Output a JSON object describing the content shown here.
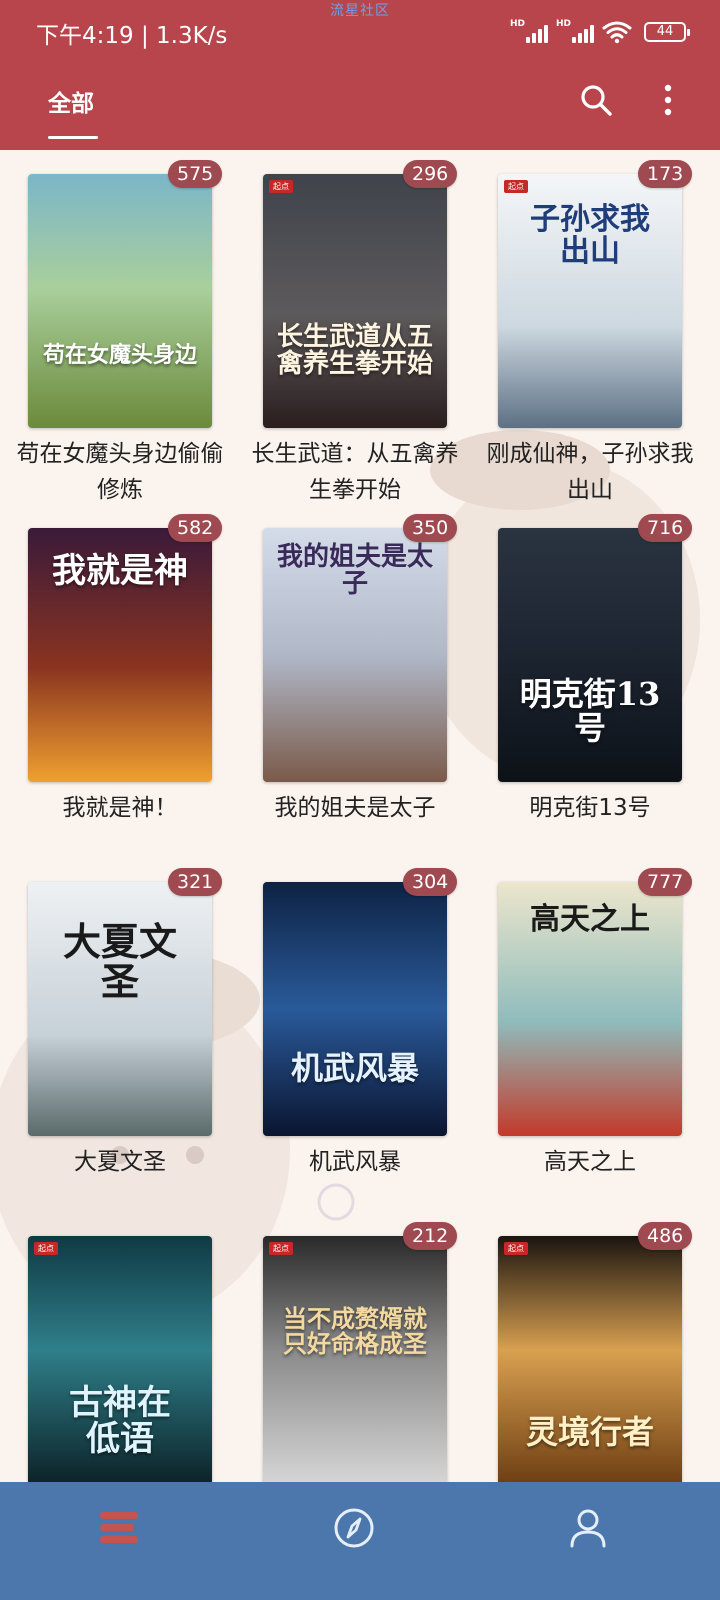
{
  "status_bar": {
    "time_speed": "下午4:19 | 1.3K/s",
    "watermark": "流星社区",
    "hd1": "HD",
    "hd2": "HD",
    "battery": "44"
  },
  "app_bar": {
    "tab_label": "全部",
    "icons": [
      "search-icon",
      "more-vert-icon"
    ]
  },
  "books": [
    {
      "title": "苟在女魔头身边偷偷修炼",
      "count": "575",
      "cover_text": "苟在女魔头身边",
      "colors": [
        "#7bb6c9",
        "#c6d69a",
        "#6b8a3a"
      ]
    },
    {
      "title": "长生武道：从五禽养生拳开始",
      "count": "296",
      "cover_text": "长生武道从五禽养生拳开始",
      "colors": [
        "#4a4d55",
        "#6a5a5a",
        "#8a2a2a"
      ]
    },
    {
      "title": "刚成仙神，子孙求我出山",
      "count": "173",
      "cover_text": "子孙求我出山",
      "colors": [
        "#eef2f5",
        "#c9d6de",
        "#5c7084"
      ]
    },
    {
      "title": "我就是神！",
      "count": "582",
      "cover_text": "我就是神",
      "colors": [
        "#3a1a3a",
        "#b8461a",
        "#f0a030"
      ]
    },
    {
      "title": "我的姐夫是太子",
      "count": "350",
      "cover_text": "我的姐夫是太子",
      "colors": [
        "#cfd8e6",
        "#b0b8c8",
        "#7a5a4a"
      ]
    },
    {
      "title": "明克街13号",
      "count": "716",
      "cover_text": "明克街13号",
      "colors": [
        "#1c2430",
        "#3a4a5a",
        "#0d1218"
      ]
    },
    {
      "title": "大夏文圣",
      "count": "321",
      "cover_text": "大夏文圣",
      "colors": [
        "#e8ecef",
        "#c7d1d8",
        "#5a6a6a"
      ]
    },
    {
      "title": "机武风暴",
      "count": "304",
      "cover_text": "机武风暴",
      "colors": [
        "#0d2244",
        "#2a5a9a",
        "#0a1530"
      ]
    },
    {
      "title": "高天之上",
      "count": "777",
      "cover_text": "高天之上",
      "colors": [
        "#e6e0c8",
        "#7fb2b4",
        "#c23a2a"
      ]
    },
    {
      "title": "",
      "count": "",
      "cover_text": "古神在低语",
      "colors": [
        "#0f3a44",
        "#2f7f8a",
        "#0b1e24"
      ]
    },
    {
      "title": "",
      "count": "212",
      "cover_text": "当不成赘婿就只好命格成圣",
      "colors": [
        "#2a2a2a",
        "#8a8a8a",
        "#d9d9d9"
      ]
    },
    {
      "title": "",
      "count": "486",
      "cover_text": "灵境行者",
      "colors": [
        "#1a1410",
        "#d8a050",
        "#6a3a10"
      ]
    }
  ],
  "bottom_nav": {
    "items": [
      "bookshelf-icon",
      "compass-icon",
      "person-icon"
    ],
    "accent": "#c2554f"
  }
}
